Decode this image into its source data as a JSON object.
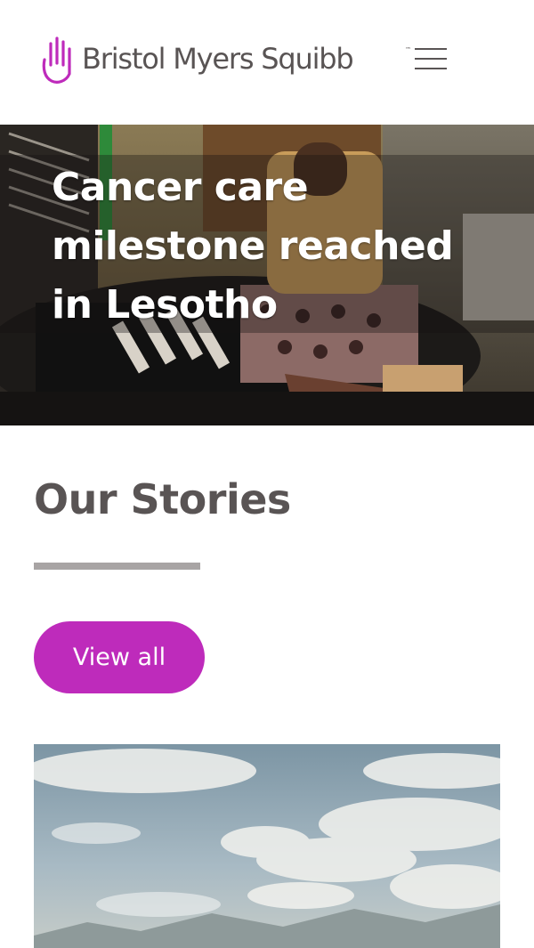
{
  "header": {
    "logo_text": "Bristol Myers Squibb",
    "trademark": "™"
  },
  "hero": {
    "title": "Cancer care milestone reached in Lesotho"
  },
  "stories": {
    "heading": "Our Stories",
    "view_all_label": "View all"
  },
  "colors": {
    "brand_purple": "#BE2BBB",
    "text_gray": "#595454",
    "rule_gray": "#A8A4A4"
  },
  "icons": {
    "logo": "hand-icon",
    "menu": "hamburger-menu-icon"
  }
}
